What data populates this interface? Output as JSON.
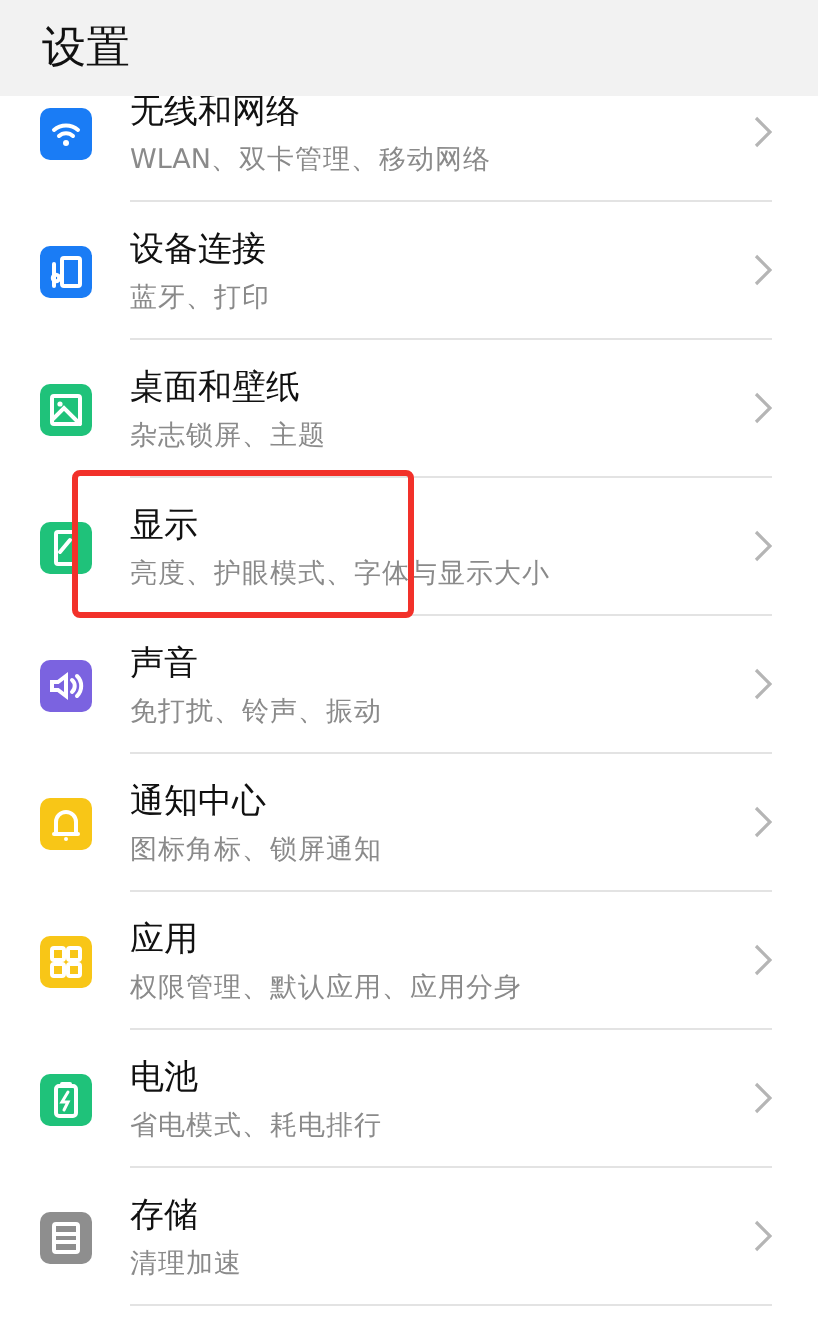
{
  "header": {
    "title": "设置"
  },
  "items": [
    {
      "kind": "wifi",
      "title": "无线和网络",
      "subtitle": "WLAN、双卡管理、移动网络",
      "highlighted": false
    },
    {
      "kind": "devices",
      "title": "设备连接",
      "subtitle": "蓝牙、打印",
      "highlighted": false
    },
    {
      "kind": "wallpaper",
      "title": "桌面和壁纸",
      "subtitle": "杂志锁屏、主题",
      "highlighted": false
    },
    {
      "kind": "display",
      "title": "显示",
      "subtitle": "亮度、护眼模式、字体与显示大小",
      "highlighted": true
    },
    {
      "kind": "sound",
      "title": "声音",
      "subtitle": "免打扰、铃声、振动",
      "highlighted": false
    },
    {
      "kind": "notify",
      "title": "通知中心",
      "subtitle": "图标角标、锁屏通知",
      "highlighted": false
    },
    {
      "kind": "apps",
      "title": "应用",
      "subtitle": "权限管理、默认应用、应用分身",
      "highlighted": false
    },
    {
      "kind": "battery",
      "title": "电池",
      "subtitle": "省电模式、耗电排行",
      "highlighted": false
    },
    {
      "kind": "storage",
      "title": "存储",
      "subtitle": "清理加速",
      "highlighted": false
    }
  ]
}
